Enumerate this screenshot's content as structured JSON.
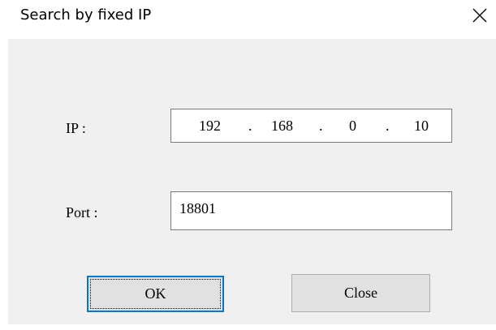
{
  "window": {
    "title": "Search by fixed IP",
    "close_icon": "close-icon"
  },
  "form": {
    "ip_label": "IP :",
    "ip_octets": [
      "192",
      "168",
      "0",
      "10"
    ],
    "ip_separator": ".",
    "port_label": "Port :",
    "port_value": "18801"
  },
  "buttons": {
    "ok_label": "OK",
    "close_label": "Close"
  },
  "colors": {
    "client_background": "#f0f0f0",
    "focus_border": "#0078d7",
    "button_face": "#e1e1e1"
  }
}
